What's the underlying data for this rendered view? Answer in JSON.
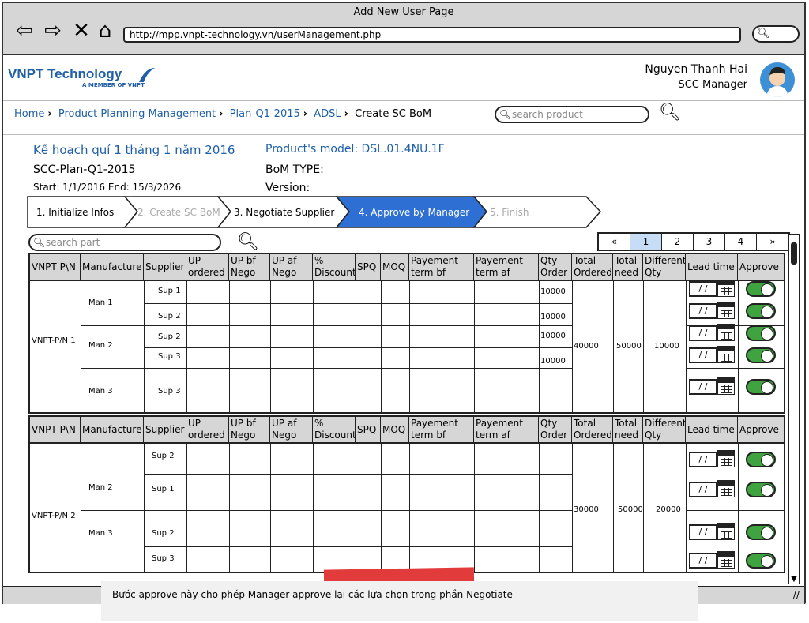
{
  "window": {
    "title": "Add New User Page",
    "url": "http://mpp.vnpt-technology.vn/userManagement.php"
  },
  "logo": {
    "name": "VNPT Technology",
    "tagline": "A MEMBER OF VNPT"
  },
  "user": {
    "name": "Nguyen Thanh Hai",
    "role": "SCC Manager"
  },
  "breadcrumb": [
    "Home",
    "Product Planning Management",
    "Plan-Q1-2015",
    "ADSL",
    "Create SC BoM"
  ],
  "product_search": {
    "placeholder": "search product"
  },
  "plan": {
    "title": "Kế hoạch quí 1 tháng 1 năm 2016",
    "id": "SCC-Plan-Q1-2015",
    "dates": "Start: 1/1/2016 End: 15/3/2026"
  },
  "product": {
    "model": "Product's model: DSL.01.4NU.1F",
    "bom_type": "BoM TYPE:",
    "version": "Version:"
  },
  "steps": [
    "1. Initialize Infos",
    "2. Create SC BoM",
    "3. Negotiate Supplier",
    "4. Approve by Manager",
    "5. Finish"
  ],
  "part_search": {
    "placeholder": "search part"
  },
  "pager": [
    "«",
    "1",
    "2",
    "3",
    "4",
    "»"
  ],
  "columns": [
    "VNPT P\\N",
    "Manufacture",
    "Supplier",
    "UP ordered",
    "UP bf Nego",
    "UP af Nego",
    "% Discount",
    "SPQ",
    "MOQ",
    "Payement term bf nego",
    "Payement term af nego",
    "Qty Order",
    "Total Ordered",
    "Total need",
    "Different Qty",
    "Lead time",
    "Approve"
  ],
  "table1": {
    "pn": "VNPT-P/N 1",
    "manufacturers": [
      "Man 1",
      "Man 2",
      "Man 3"
    ],
    "suppliers": [
      "Sup 1",
      "Sup 2",
      "Sup 2",
      "Sup 3",
      "Sup 3"
    ],
    "qty": [
      "10000",
      "10000",
      "10000",
      "10000"
    ],
    "total_ordered": "40000",
    "total_need": "50000",
    "different": "10000",
    "date_placeholder": "/ /"
  },
  "table2": {
    "pn": "VNPT-P/N 2",
    "manufacturers": [
      "Man 2",
      "Man 3"
    ],
    "suppliers": [
      "Sup 2",
      "Sup 1",
      "Sup 2",
      "Sup 3"
    ],
    "total_ordered": "30000",
    "total_need": "50000",
    "different": "20000",
    "date_placeholder": "/ /"
  },
  "note": "Bước approve này cho phép Manager approve lại các lựa chọn trong phần Negotiate"
}
